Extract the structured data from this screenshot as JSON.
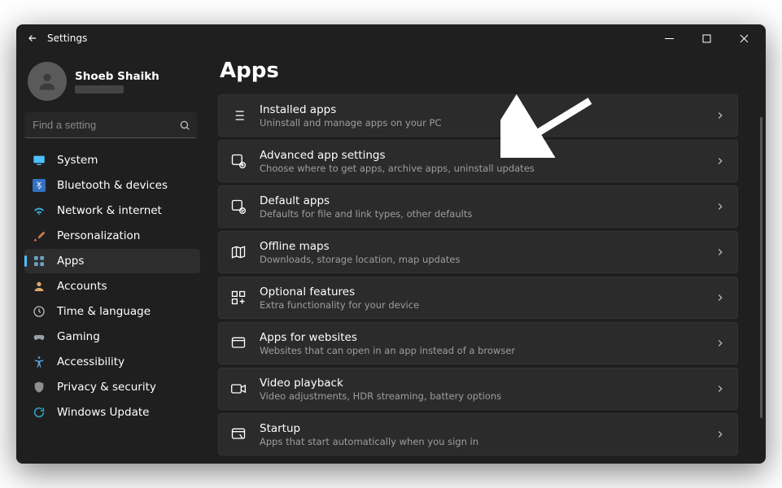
{
  "app_title": "Settings",
  "user": {
    "name": "Shoeb Shaikh"
  },
  "search": {
    "placeholder": "Find a setting"
  },
  "nav": [
    {
      "label": "System",
      "icon": "display-icon",
      "color": "#4cc2ff"
    },
    {
      "label": "Bluetooth & devices",
      "icon": "bluetooth-icon",
      "color": "#4a84d6"
    },
    {
      "label": "Network & internet",
      "icon": "wifi-icon",
      "color": "#35b4df"
    },
    {
      "label": "Personalization",
      "icon": "brush-icon",
      "color": "#d17a53"
    },
    {
      "label": "Apps",
      "icon": "apps-icon",
      "color": "#6ea3c4",
      "selected": true
    },
    {
      "label": "Accounts",
      "icon": "person-icon",
      "color": "#e0a570"
    },
    {
      "label": "Time & language",
      "icon": "clock-icon",
      "color": "#bdbdbd"
    },
    {
      "label": "Gaming",
      "icon": "gamepad-icon",
      "color": "#9aa0a6"
    },
    {
      "label": "Accessibility",
      "icon": "accessibility-icon",
      "color": "#5aa0d8"
    },
    {
      "label": "Privacy & security",
      "icon": "shield-icon",
      "color": "#8f8f8f"
    },
    {
      "label": "Windows Update",
      "icon": "update-icon",
      "color": "#2f9cc2"
    }
  ],
  "page_title": "Apps",
  "cards": [
    {
      "title": "Installed apps",
      "sub": "Uninstall and manage apps on your PC",
      "icon": "list-icon"
    },
    {
      "title": "Advanced app settings",
      "sub": "Choose where to get apps, archive apps, uninstall updates",
      "icon": "settings-app-icon"
    },
    {
      "title": "Default apps",
      "sub": "Defaults for file and link types, other defaults",
      "icon": "default-app-icon"
    },
    {
      "title": "Offline maps",
      "sub": "Downloads, storage location, map updates",
      "icon": "map-icon"
    },
    {
      "title": "Optional features",
      "sub": "Extra functionality for your device",
      "icon": "grid-plus-icon"
    },
    {
      "title": "Apps for websites",
      "sub": "Websites that can open in an app instead of a browser",
      "icon": "web-app-icon"
    },
    {
      "title": "Video playback",
      "sub": "Video adjustments, HDR streaming, battery options",
      "icon": "video-icon"
    },
    {
      "title": "Startup",
      "sub": "Apps that start automatically when you sign in",
      "icon": "startup-icon"
    }
  ]
}
